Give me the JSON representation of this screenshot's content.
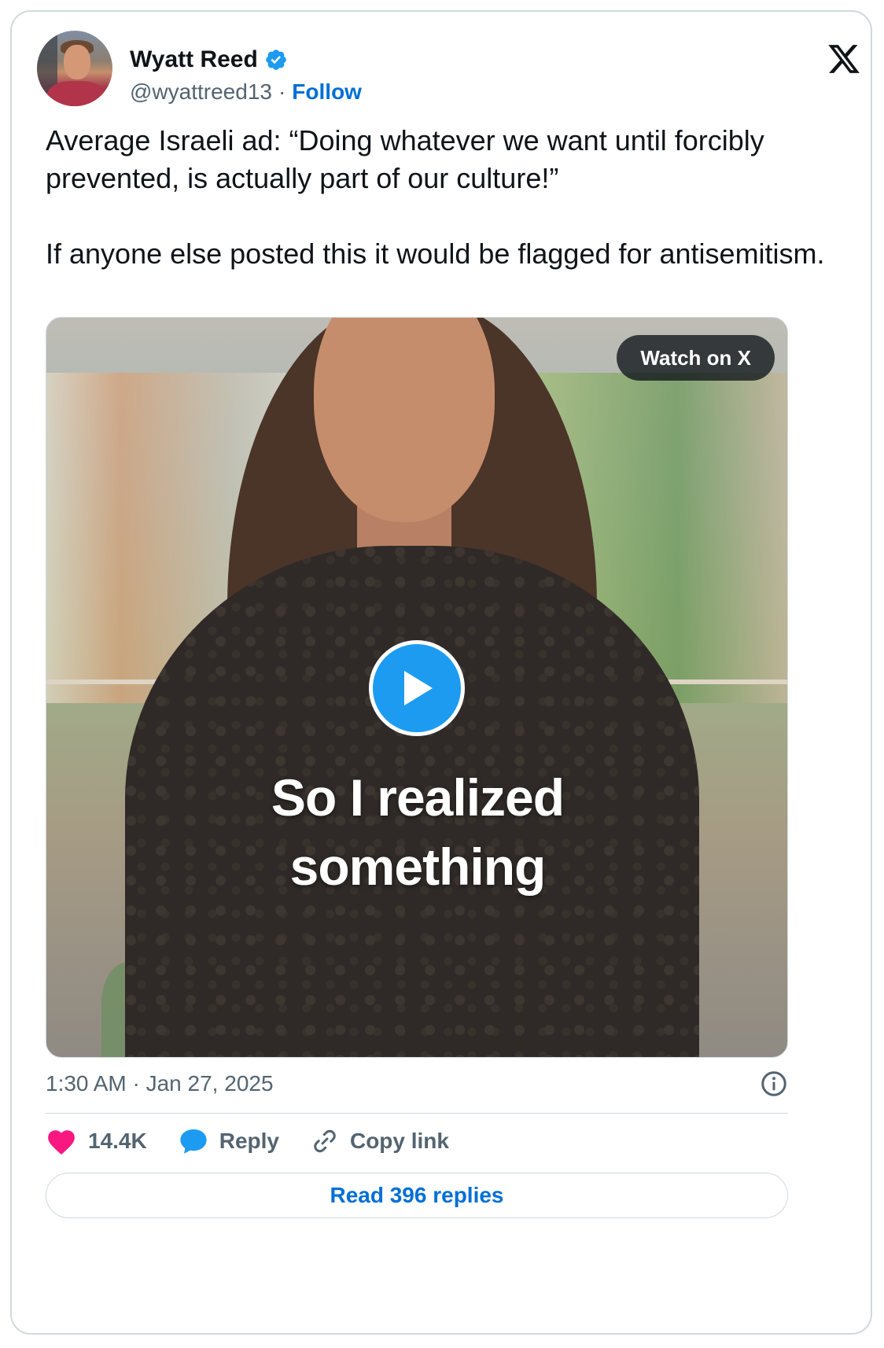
{
  "author": {
    "name": "Wyatt Reed",
    "handle": "@wyattreed13",
    "separator": "·",
    "follow_label": "Follow",
    "verified": true,
    "verified_color": "#1d9bf0"
  },
  "tweet": {
    "paragraphs": [
      "Average Israeli ad: “Doing whatever we want until forcibly prevented, is actually part of our culture!”",
      "If anyone else posted this it would be flagged for antisemitism."
    ]
  },
  "media": {
    "type": "video",
    "watch_label": "Watch on X",
    "caption_line1": "So I realized",
    "caption_line2": "something",
    "play_icon": "play-icon",
    "accent": "#1d9bf0"
  },
  "timestamp": "1:30 AM · Jan 27, 2025",
  "actions": {
    "likes": "14.4K",
    "reply_label": "Reply",
    "copy_label": "Copy link",
    "like_color": "#f91880",
    "reply_color": "#1d9bf0"
  },
  "read_replies_label": "Read 396 replies",
  "icons": {
    "logo": "x-logo-icon",
    "info": "info-icon",
    "like": "heart-icon",
    "reply": "reply-bubble-icon",
    "copy": "link-icon"
  }
}
